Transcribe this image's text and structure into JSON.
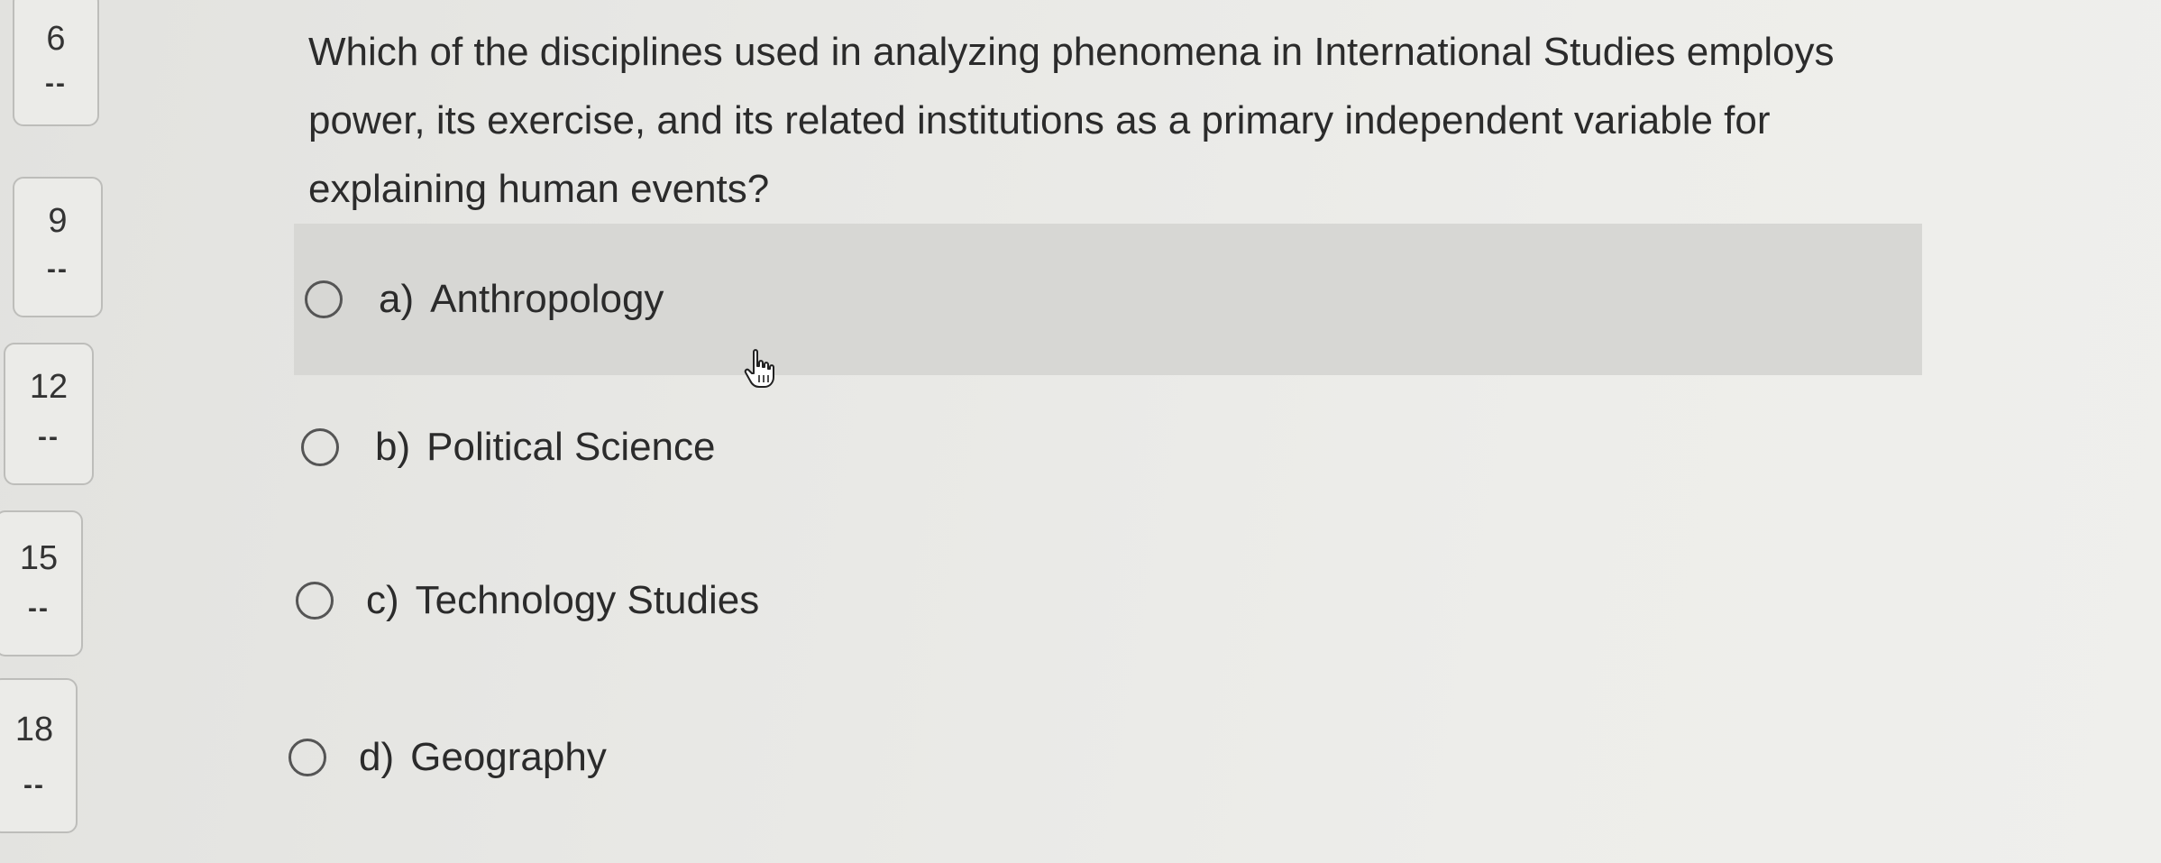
{
  "nav": [
    {
      "number": "6",
      "status": "--"
    },
    {
      "number": "9",
      "status": "--"
    },
    {
      "number": "12",
      "status": "--"
    },
    {
      "number": "15",
      "status": "--"
    },
    {
      "number": "18",
      "status": "--"
    }
  ],
  "question": {
    "text": "Which of the disciplines used in analyzing phenomena in International Studies employs power, its exercise, and its related institutions as a primary independent variable for explaining human events?"
  },
  "options": [
    {
      "letter": "a)",
      "label": "Anthropology"
    },
    {
      "letter": "b)",
      "label": "Political Science"
    },
    {
      "letter": "c)",
      "label": "Technology Studies"
    },
    {
      "letter": "d)",
      "label": "Geography"
    }
  ],
  "colors": {
    "hover_row": "#d7d7d4",
    "background": "#e8e8e5"
  },
  "icons": {
    "cursor": "hand-pointer-icon"
  }
}
